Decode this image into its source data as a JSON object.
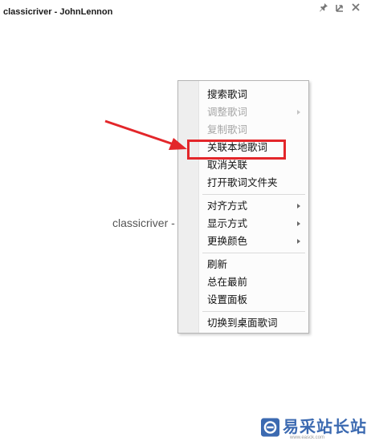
{
  "window": {
    "title": "classicriver - JohnLennon",
    "controls": [
      {
        "icon": "pin-icon"
      },
      {
        "icon": "restore-icon"
      },
      {
        "icon": "close-icon"
      }
    ]
  },
  "lyrics": {
    "current_line": "classicriver -"
  },
  "context_menu": {
    "groups": [
      [
        {
          "label": "搜索歌词",
          "disabled": false,
          "submenu": false
        },
        {
          "label": "调整歌词",
          "disabled": true,
          "submenu": true
        },
        {
          "label": "复制歌词",
          "disabled": true,
          "submenu": false
        },
        {
          "label": "关联本地歌词",
          "disabled": false,
          "submenu": false,
          "highlighted": true
        },
        {
          "label": "取消关联",
          "disabled": false,
          "submenu": false
        },
        {
          "label": "打开歌词文件夹",
          "disabled": false,
          "submenu": false
        }
      ],
      [
        {
          "label": "对齐方式",
          "disabled": false,
          "submenu": true
        },
        {
          "label": "显示方式",
          "disabled": false,
          "submenu": true
        },
        {
          "label": "更换颜色",
          "disabled": false,
          "submenu": true
        }
      ],
      [
        {
          "label": "刷新",
          "disabled": false,
          "submenu": false
        },
        {
          "label": "总在最前",
          "disabled": false,
          "submenu": false
        },
        {
          "label": "设置面板",
          "disabled": false,
          "submenu": false
        }
      ],
      [
        {
          "label": "切换到桌面歌词",
          "disabled": false,
          "submenu": false
        }
      ]
    ]
  },
  "annotation": {
    "color": "#e3262a"
  },
  "watermark": {
    "text": "易采站长站",
    "subtext": "www.easck.com",
    "color": "#3c6ab1"
  }
}
